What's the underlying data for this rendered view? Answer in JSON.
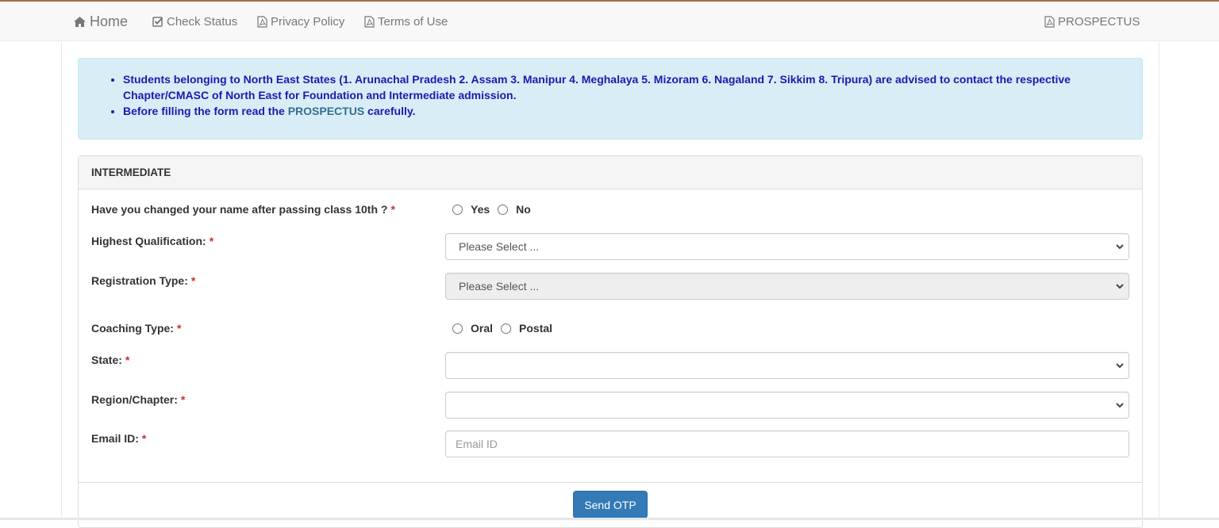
{
  "navbar": {
    "items": [
      {
        "label": "Home",
        "icon": "home-icon"
      },
      {
        "label": "Check Status",
        "icon": "check-square-icon"
      },
      {
        "label": "Privacy Policy",
        "icon": "pdf-file-icon"
      },
      {
        "label": "Terms of Use",
        "icon": "pdf-file-icon"
      }
    ],
    "right_item": {
      "label": "PROSPECTUS",
      "icon": "pdf-file-icon"
    }
  },
  "alert": {
    "line1": "Students belonging to North East States (1. Arunachal Pradesh 2. Assam 3. Manipur 4. Meghalaya 5. Mizoram 6. Nagaland 7. Sikkim 8. Tripura) are advised to contact the respective Chapter/CMASC of North East for Foundation and Intermediate admission.",
    "line2_prefix": "Before filling the form read the ",
    "line2_link": "PROSPECTUS",
    "line2_suffix": " carefully."
  },
  "panel": {
    "heading": "INTERMEDIATE",
    "required_marker": "*",
    "fields": {
      "name_change": {
        "label": "Have you changed your name after passing class 10th ?",
        "options": [
          "Yes",
          "No"
        ],
        "selected": null
      },
      "highest_qualification": {
        "label": "Highest Qualification:",
        "value": "Please Select ..."
      },
      "registration_type": {
        "label": "Registration Type:",
        "value": "Please Select ...",
        "disabled": true
      },
      "coaching_type": {
        "label": "Coaching Type:",
        "options": [
          "Oral",
          "Postal"
        ],
        "selected": null
      },
      "state": {
        "label": "State:",
        "value": ""
      },
      "region_chapter": {
        "label": "Region/Chapter:",
        "value": ""
      },
      "email": {
        "label": "Email ID:",
        "value": "",
        "placeholder": "Email ID"
      }
    },
    "submit_label": "Send OTP"
  },
  "colors": {
    "primary_button": "#337ab7",
    "alert_bg": "#d9edf7",
    "alert_text": "#1a1ab0",
    "link": "#31708f",
    "required": "#c9302c"
  }
}
